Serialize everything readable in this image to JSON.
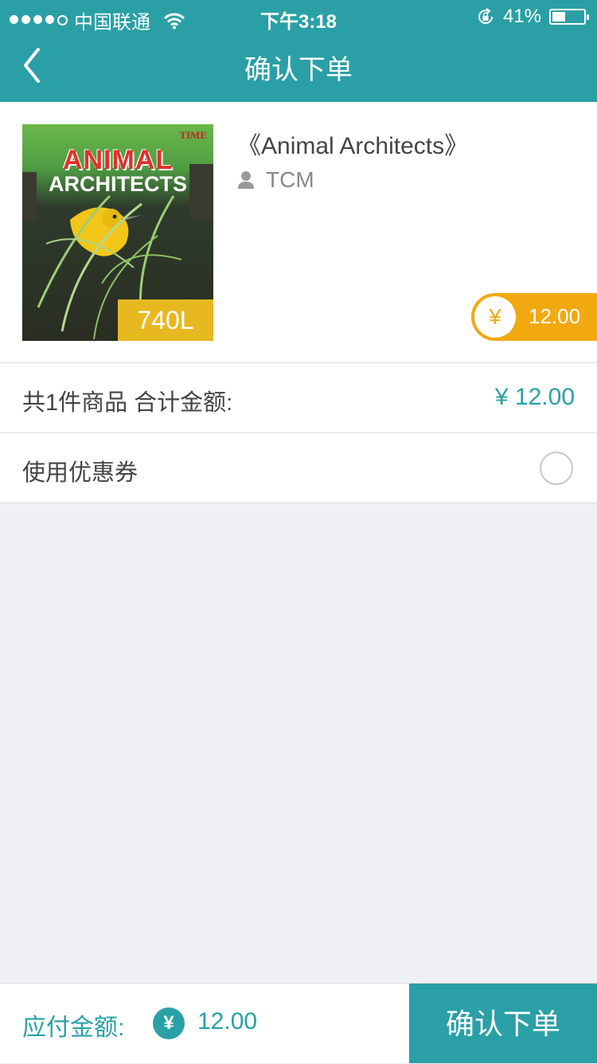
{
  "status_bar": {
    "carrier": "中国联通",
    "time": "下午3:18",
    "battery": "41%",
    "battery_level": 0.41
  },
  "nav": {
    "title": "确认下单",
    "back_icon": "chevron-left-icon"
  },
  "product": {
    "cover_brand": "TIME",
    "cover_title_line1": "ANIMAL",
    "cover_title_line2": "ARCHITECTS",
    "level": "740L",
    "title": "《Animal Architects》",
    "author": "TCM",
    "price_symbol": "¥",
    "price": "12.00"
  },
  "summary": {
    "label": "共1件商品  合计金额:",
    "amount": "¥ 12.00"
  },
  "coupon": {
    "label": "使用优惠券"
  },
  "footer": {
    "pay_label": "应付金额:",
    "currency_symbol": "¥",
    "pay_amount": "12.00",
    "confirm_label": "确认下单"
  },
  "colors": {
    "primary": "#2aa0a6",
    "price_badge": "#f2a910",
    "level_badge": "#e8b820",
    "background": "#eff0f4"
  }
}
